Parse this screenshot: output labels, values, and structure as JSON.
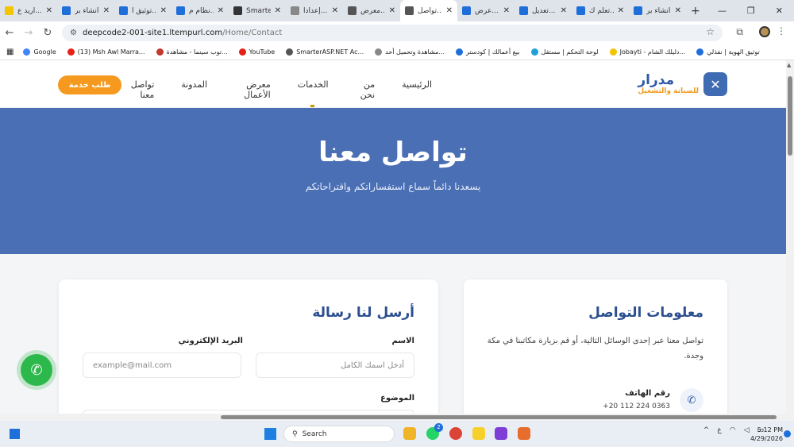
{
  "browser": {
    "tabs": [
      {
        "title": "اريد ع...",
        "color": "#f3c400"
      },
      {
        "title": "انشاء بر...",
        "color": "#1e6fd9"
      },
      {
        "title": "توثيق ا...",
        "color": "#1e6fd9"
      },
      {
        "title": "نظام م...",
        "color": "#1e6fd9"
      },
      {
        "title": "Smarte...",
        "color": "#333"
      },
      {
        "title": "إعدادا...",
        "color": "#888"
      },
      {
        "title": "معرض...",
        "color": "#555"
      },
      {
        "title": "تواصل...",
        "color": "#555"
      },
      {
        "title": "عرض...",
        "color": "#1e6fd9"
      },
      {
        "title": "تعديل...",
        "color": "#1e6fd9"
      },
      {
        "title": "تعلم ك...",
        "color": "#1e6fd9"
      },
      {
        "title": "انشاء بر...",
        "color": "#1e6fd9"
      }
    ],
    "active_tab_index": 7,
    "url_host": "deepcode2-001-site1.ltempurl.com",
    "url_path": "/Home/Contact",
    "bookmarks": [
      {
        "label": "Google",
        "color": "#4285f4"
      },
      {
        "label": "(13) Msh Awl Marra...",
        "color": "#e62117"
      },
      {
        "label": "توب سينما - مشاهدة...",
        "color": "#c0392b"
      },
      {
        "label": "YouTube",
        "color": "#e62117"
      },
      {
        "label": "SmarterASP.NET Ac...",
        "color": "#555"
      },
      {
        "label": "مشاهدة وتحميل أحد...",
        "color": "#888"
      },
      {
        "label": "بيع أعمالك | كودستر",
        "color": "#1e6fd9"
      },
      {
        "label": "لوحة التحكم | مستقل",
        "color": "#1fa0d6"
      },
      {
        "label": "Jobayti - دليلك الشام...",
        "color": "#f3c400"
      },
      {
        "label": "توثيق الهوية | نفذلي",
        "color": "#1e6fd9"
      }
    ]
  },
  "site": {
    "logo_name": "مدرار",
    "logo_sub": "للصيانة والتشغيل",
    "nav": [
      "الرئيسية",
      "من نحن",
      "الخدمات",
      "معرض الأعمال",
      "المدونة",
      "تواصل معنا"
    ],
    "cta": "طلب خدمة",
    "hero_title": "تواصل معنا",
    "hero_subtitle": "يسعدنا دائماً سماع استفساراتكم واقتراحاتكم",
    "form": {
      "title": "أرسل لنا رسالة",
      "name_label": "الاسم",
      "name_placeholder": "أدخل اسمك الكامل",
      "email_label": "البريد الإلكتروني",
      "email_placeholder": "example@mail.com",
      "subject_label": "الموضوع"
    },
    "info": {
      "title": "معلومات التواصل",
      "desc": "تواصل معنا عبر إحدى الوسائل التالية، أو قم بزيارة مكاتبنا في مكة وجدة.",
      "phone_label": "رقم الهاتف",
      "phone_value": "+20 112 224 0363"
    }
  },
  "taskbar": {
    "search": "Search",
    "tray_lang": "ع",
    "time": "5:12 PM",
    "date": "4/29/2026",
    "whatsapp_badge": "2"
  }
}
